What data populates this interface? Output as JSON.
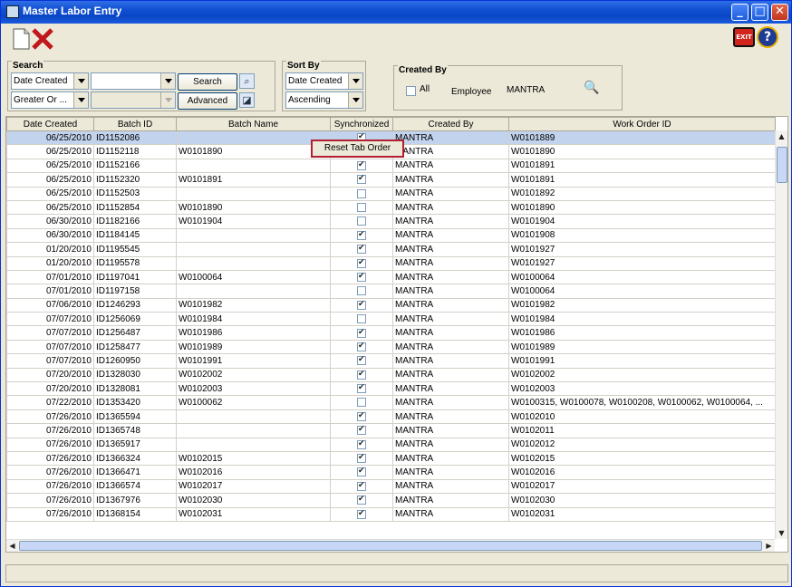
{
  "window": {
    "title": "Master Labor Entry"
  },
  "toolbar": {
    "new_icon": "new-document-icon",
    "delete_icon": "delete-x-icon",
    "exit_label": "EXIT",
    "help_label": "?"
  },
  "search": {
    "title": "Search",
    "field_value": "Date Created",
    "operator_value": "Greater Or ...",
    "search_button": "Search",
    "advanced_button": "Advanced"
  },
  "sort": {
    "title": "Sort By",
    "field_value": "Date Created",
    "order_value": "Ascending"
  },
  "created_by": {
    "title": "Created By",
    "all_label": "All",
    "employee_label": "Employee",
    "employee_value": "MANTRA"
  },
  "table": {
    "columns": [
      "Date Created",
      "Batch ID",
      "Batch Name",
      "Synchronized",
      "Created By",
      "Work Order ID"
    ],
    "rows": [
      {
        "date": "06/25/2010",
        "batch_id": "ID1152086",
        "batch_name": "",
        "sync": true,
        "created_by": "MANTRA",
        "wo": "W0101889"
      },
      {
        "date": "06/25/2010",
        "batch_id": "ID1152118",
        "batch_name": "W0101890",
        "sync": false,
        "created_by": "MANTRA",
        "wo": "W0101890"
      },
      {
        "date": "06/25/2010",
        "batch_id": "ID1152166",
        "batch_name": "",
        "sync": true,
        "created_by": "MANTRA",
        "wo": "W0101891"
      },
      {
        "date": "06/25/2010",
        "batch_id": "ID1152320",
        "batch_name": "W0101891",
        "sync": true,
        "created_by": "MANTRA",
        "wo": "W0101891"
      },
      {
        "date": "06/25/2010",
        "batch_id": "ID1152503",
        "batch_name": "",
        "sync": false,
        "created_by": "MANTRA",
        "wo": "W0101892"
      },
      {
        "date": "06/25/2010",
        "batch_id": "ID1152854",
        "batch_name": "W0101890",
        "sync": false,
        "created_by": "MANTRA",
        "wo": "W0101890"
      },
      {
        "date": "06/30/2010",
        "batch_id": "ID1182166",
        "batch_name": "W0101904",
        "sync": false,
        "created_by": "MANTRA",
        "wo": "W0101904"
      },
      {
        "date": "06/30/2010",
        "batch_id": "ID1184145",
        "batch_name": "",
        "sync": true,
        "created_by": "MANTRA",
        "wo": "W0101908"
      },
      {
        "date": "01/20/2010",
        "batch_id": "ID1195545",
        "batch_name": "",
        "sync": true,
        "created_by": "MANTRA",
        "wo": "W0101927"
      },
      {
        "date": "01/20/2010",
        "batch_id": "ID1195578",
        "batch_name": "",
        "sync": true,
        "created_by": "MANTRA",
        "wo": "W0101927"
      },
      {
        "date": "07/01/2010",
        "batch_id": "ID1197041",
        "batch_name": "W0100064",
        "sync": true,
        "created_by": "MANTRA",
        "wo": "W0100064"
      },
      {
        "date": "07/01/2010",
        "batch_id": "ID1197158",
        "batch_name": "",
        "sync": false,
        "created_by": "MANTRA",
        "wo": "W0100064"
      },
      {
        "date": "07/06/2010",
        "batch_id": "ID1246293",
        "batch_name": "W0101982",
        "sync": true,
        "created_by": "MANTRA",
        "wo": "W0101982"
      },
      {
        "date": "07/07/2010",
        "batch_id": "ID1256069",
        "batch_name": "W0101984",
        "sync": false,
        "created_by": "MANTRA",
        "wo": "W0101984"
      },
      {
        "date": "07/07/2010",
        "batch_id": "ID1256487",
        "batch_name": "W0101986",
        "sync": true,
        "created_by": "MANTRA",
        "wo": "W0101986"
      },
      {
        "date": "07/07/2010",
        "batch_id": "ID1258477",
        "batch_name": "W0101989",
        "sync": true,
        "created_by": "MANTRA",
        "wo": "W0101989"
      },
      {
        "date": "07/07/2010",
        "batch_id": "ID1260950",
        "batch_name": "W0101991",
        "sync": true,
        "created_by": "MANTRA",
        "wo": "W0101991"
      },
      {
        "date": "07/20/2010",
        "batch_id": "ID1328030",
        "batch_name": "W0102002",
        "sync": true,
        "created_by": "MANTRA",
        "wo": "W0102002"
      },
      {
        "date": "07/20/2010",
        "batch_id": "ID1328081",
        "batch_name": "W0102003",
        "sync": true,
        "created_by": "MANTRA",
        "wo": "W0102003"
      },
      {
        "date": "07/22/2010",
        "batch_id": "ID1353420",
        "batch_name": "W0100062",
        "sync": false,
        "created_by": "MANTRA",
        "wo": "W0100315, W0100078, W0100208, W0100062, W0100064, ..."
      },
      {
        "date": "07/26/2010",
        "batch_id": "ID1365594",
        "batch_name": "",
        "sync": true,
        "created_by": "MANTRA",
        "wo": "W0102010"
      },
      {
        "date": "07/26/2010",
        "batch_id": "ID1365748",
        "batch_name": "",
        "sync": true,
        "created_by": "MANTRA",
        "wo": "W0102011"
      },
      {
        "date": "07/26/2010",
        "batch_id": "ID1365917",
        "batch_name": "",
        "sync": true,
        "created_by": "MANTRA",
        "wo": "W0102012"
      },
      {
        "date": "07/26/2010",
        "batch_id": "ID1366324",
        "batch_name": "W0102015",
        "sync": true,
        "created_by": "MANTRA",
        "wo": "W0102015"
      },
      {
        "date": "07/26/2010",
        "batch_id": "ID1366471",
        "batch_name": "W0102016",
        "sync": true,
        "created_by": "MANTRA",
        "wo": "W0102016"
      },
      {
        "date": "07/26/2010",
        "batch_id": "ID1366574",
        "batch_name": "W0102017",
        "sync": true,
        "created_by": "MANTRA",
        "wo": "W0102017"
      },
      {
        "date": "07/26/2010",
        "batch_id": "ID1367976",
        "batch_name": "W0102030",
        "sync": true,
        "created_by": "MANTRA",
        "wo": "W0102030"
      },
      {
        "date": "07/26/2010",
        "batch_id": "ID1368154",
        "batch_name": "W0102031",
        "sync": true,
        "created_by": "MANTRA",
        "wo": "W0102031"
      }
    ]
  },
  "context_menu": {
    "item": "Reset Tab Order"
  },
  "colors": {
    "titlebar": "#0a46c6",
    "selected_row": "#c2d3ee",
    "context_border": "#b02030"
  }
}
